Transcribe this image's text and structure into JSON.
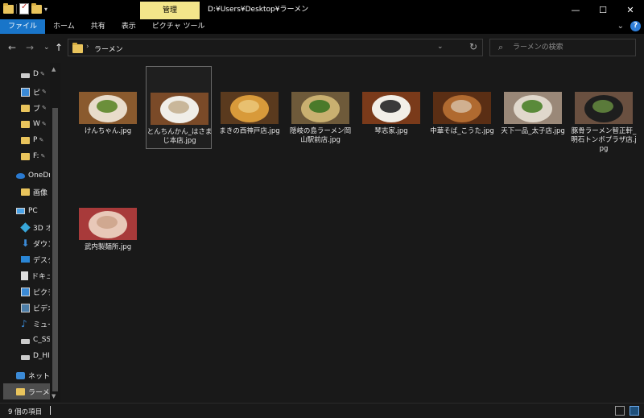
{
  "window": {
    "context_tab": "管理",
    "title": "D:¥Users¥Desktop¥ラーメン",
    "minimize": "—",
    "maximize": "☐",
    "close": "✕"
  },
  "ribbon": {
    "tabs": [
      {
        "label": "ファイル",
        "active": true
      },
      {
        "label": "ホーム",
        "active": false
      },
      {
        "label": "共有",
        "active": false
      },
      {
        "label": "表示",
        "active": false
      },
      {
        "label": "ピクチャ ツール",
        "active": false
      }
    ],
    "collapse": "⌄",
    "help": "?"
  },
  "nav": {
    "back": "←",
    "forward": "→",
    "recent": "⌄",
    "up": "↑"
  },
  "address": {
    "separator": "›",
    "crumb": "ラーメン",
    "dropdown": "⌄",
    "refresh": "↻"
  },
  "search": {
    "icon": "⌕",
    "placeholder": "ラーメンの検索"
  },
  "navpane": {
    "items": [
      {
        "label": "D",
        "icon": "drive",
        "pinned": true,
        "selected": false
      },
      {
        "label": "ピ",
        "icon": "pic",
        "pinned": true,
        "selected": false
      },
      {
        "label": "ブ",
        "icon": "folder",
        "pinned": true,
        "selected": false
      },
      {
        "label": "W",
        "icon": "folder",
        "pinned": true,
        "selected": false
      },
      {
        "label": "P",
        "icon": "folder",
        "pinned": true,
        "selected": false
      },
      {
        "label": "F:",
        "icon": "folder",
        "pinned": true,
        "selected": false
      },
      {
        "label": "OneDrive",
        "icon": "cloud",
        "pinned": false,
        "selected": false
      },
      {
        "label": "画像",
        "icon": "folder",
        "pinned": false,
        "selected": false
      },
      {
        "label": "PC",
        "icon": "pc",
        "pinned": false,
        "selected": false
      },
      {
        "label": "3D オ",
        "icon": "3d",
        "pinned": false,
        "selected": false
      },
      {
        "label": "ダウン",
        "icon": "down",
        "pinned": false,
        "selected": false
      },
      {
        "label": "デスク",
        "icon": "desk",
        "pinned": false,
        "selected": false
      },
      {
        "label": "ドキュ",
        "icon": "doc",
        "pinned": false,
        "selected": false
      },
      {
        "label": "ピクチ",
        "icon": "pic",
        "pinned": false,
        "selected": false
      },
      {
        "label": "ビデオ",
        "icon": "vid",
        "pinned": false,
        "selected": false
      },
      {
        "label": "ミュー",
        "icon": "music",
        "pinned": false,
        "selected": false
      },
      {
        "label": "C_SS",
        "icon": "drive",
        "pinned": false,
        "selected": false
      },
      {
        "label": "D_HI",
        "icon": "drive",
        "pinned": false,
        "selected": false
      },
      {
        "label": "ネットワ",
        "icon": "net",
        "pinned": false,
        "selected": false
      },
      {
        "label": "ラーメン",
        "icon": "folder",
        "pinned": false,
        "selected": true
      }
    ],
    "pin_glyph": "📌",
    "scroll_up": "▲",
    "scroll_down": "▼"
  },
  "files": [
    {
      "name": "けんちゃん.jpg",
      "selected": false,
      "bg": "#8a5a2e",
      "bowl": "#e8dccb",
      "top": "#6b8f3a"
    },
    {
      "name": "とんちんかん_はさまじ本店.jpg",
      "selected": true,
      "bg": "#7a4a28",
      "bowl": "#f0eee8",
      "top": "#c9b79a"
    },
    {
      "name": "まきの西神戸店.jpg",
      "selected": false,
      "bg": "#5a3a1e",
      "bowl": "#d89a3a",
      "top": "#e8c070"
    },
    {
      "name": "隠岐の島ラーメン岡山駅前店.jpg",
      "selected": false,
      "bg": "#6e5a3a",
      "bowl": "#c9b070",
      "top": "#4a7a2a"
    },
    {
      "name": "琴志家.jpg",
      "selected": false,
      "bg": "#7a3a1a",
      "bowl": "#f2efe8",
      "top": "#3a3a3a"
    },
    {
      "name": "中華そば_こうた.jpg",
      "selected": false,
      "bg": "#5a2e14",
      "bowl": "#b06a30",
      "top": "#d0b090"
    },
    {
      "name": "天下一品_太子店.jpg",
      "selected": false,
      "bg": "#9a8878",
      "bowl": "#e0d8cc",
      "top": "#5a8a3a"
    },
    {
      "name": "豚骨ラーメン智正軒_明石トンボプラザ店.jpg",
      "selected": false,
      "bg": "#6a5040",
      "bowl": "#1e1e1e",
      "top": "#5a7a3a"
    },
    {
      "name": "武内製麺所.jpg",
      "selected": false,
      "bg": "#a83a3a",
      "bowl": "#e8c8b8",
      "top": "#d0a890"
    }
  ],
  "status": {
    "count": "9 個の項目"
  }
}
